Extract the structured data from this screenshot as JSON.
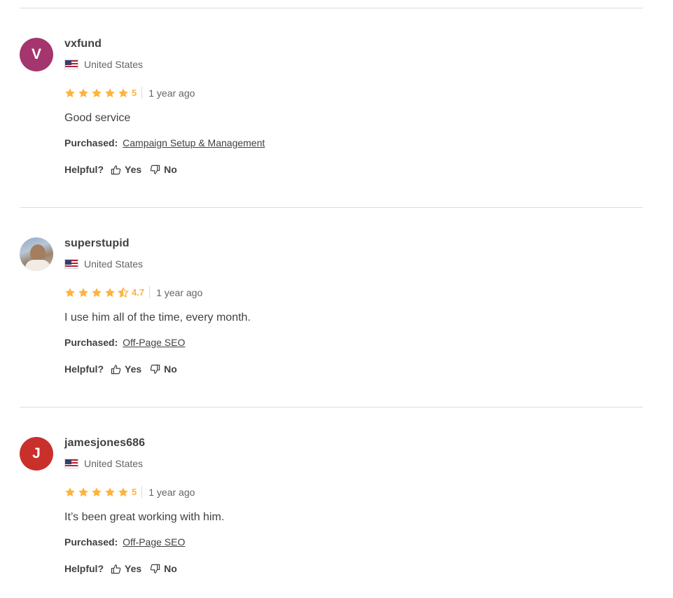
{
  "reviews": [
    {
      "avatar_letter": "V",
      "avatar_color": "#a4356e",
      "username": "vxfund",
      "country": "United States",
      "rating": 5,
      "rating_label": "5",
      "time": "1 year ago",
      "text": "Good service",
      "purchased_label": "Purchased:",
      "purchased_item": "Campaign Setup & Management",
      "helpful_label": "Helpful?",
      "yes_label": "Yes",
      "no_label": "No"
    },
    {
      "avatar_letter": "",
      "avatar_color": "",
      "username": "superstupid",
      "country": "United States",
      "rating": 4.7,
      "rating_label": "4.7",
      "time": "1 year ago",
      "text": "I use him all of the time, every month.",
      "purchased_label": "Purchased:",
      "purchased_item": "Off-Page SEO",
      "helpful_label": "Helpful?",
      "yes_label": "Yes",
      "no_label": "No"
    },
    {
      "avatar_letter": "J",
      "avatar_color": "#c9302c",
      "username": "jamesjones686",
      "country": "United States",
      "rating": 5,
      "rating_label": "5",
      "time": "1 year ago",
      "text": "It’s been great working with him.",
      "purchased_label": "Purchased:",
      "purchased_item": "Off-Page SEO",
      "helpful_label": "Helpful?",
      "yes_label": "Yes",
      "no_label": "No"
    }
  ],
  "colors": {
    "star": "#ffb33e",
    "divider": "#dadbdd",
    "text": "#404145",
    "muted": "#62646a"
  }
}
